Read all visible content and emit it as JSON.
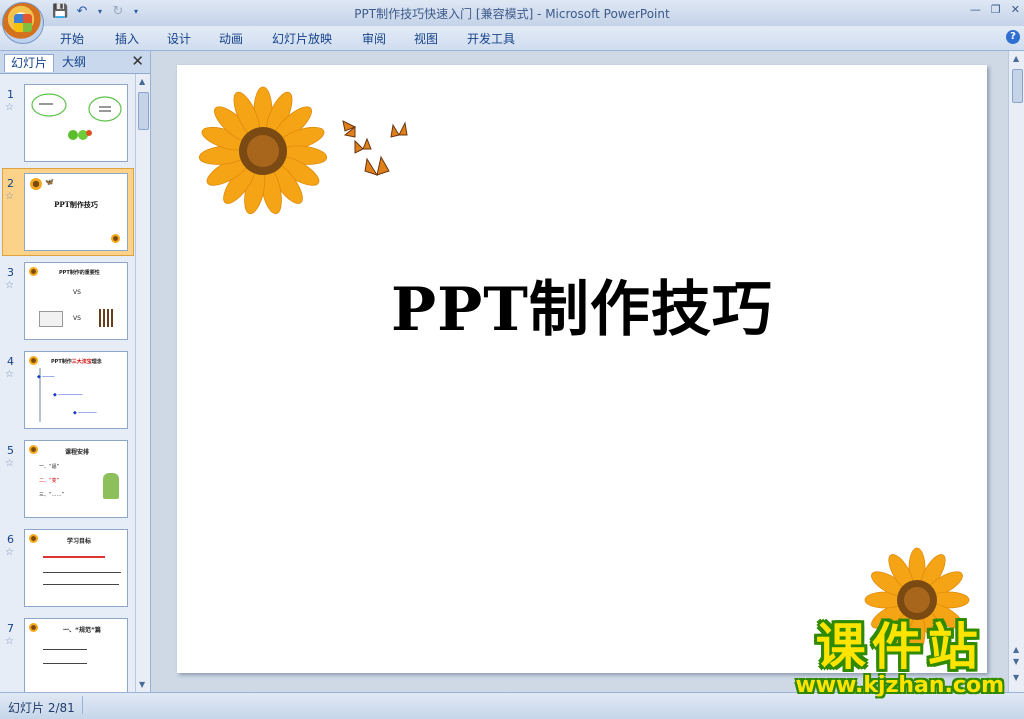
{
  "window": {
    "title": "PPT制作技巧快速入门 [兼容模式] - Microsoft PowerPoint"
  },
  "ribbon": {
    "tabs": [
      "开始",
      "插入",
      "设计",
      "动画",
      "幻灯片放映",
      "审阅",
      "视图",
      "开发工具"
    ]
  },
  "pane": {
    "tabs": [
      "幻灯片",
      "大纲"
    ],
    "active_tab": "幻灯片",
    "thumbnails": [
      {
        "number": "1",
        "selected": false
      },
      {
        "number": "2",
        "selected": true,
        "title": "PPT制作技巧"
      },
      {
        "number": "3",
        "selected": false,
        "title": "PPT制作的重要性",
        "texts": [
          "VS",
          "VS"
        ]
      },
      {
        "number": "4",
        "selected": false,
        "title_prefix": "PPT制作",
        "title_red": "三大法宝",
        "title_suffix": "理念"
      },
      {
        "number": "5",
        "selected": false,
        "title": "课程安排",
        "texts": [
          "一、“逼”",
          "二、“变”",
          "三、“……”"
        ]
      },
      {
        "number": "6",
        "selected": false,
        "title": "学习目标"
      },
      {
        "number": "7",
        "selected": false,
        "title": "一、“规范”篇"
      }
    ]
  },
  "slide": {
    "title": "PPT制作技巧"
  },
  "statusbar": {
    "slide_indicator": "幻灯片 2/81"
  },
  "watermark": {
    "main": "课件站",
    "sub": "www.kjzhan.com"
  },
  "colors": {
    "ribbon_text": "#15428b",
    "selection_orange": "#f6b04e",
    "watermark_yellow": "#ffe400",
    "watermark_green": "#2f8a00"
  }
}
